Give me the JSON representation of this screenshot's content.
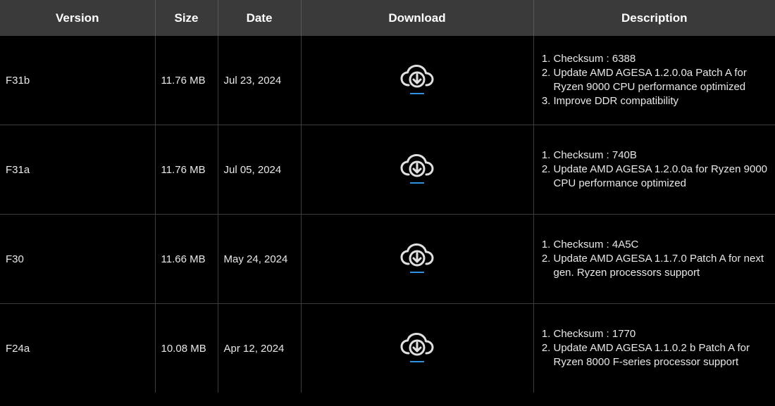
{
  "table": {
    "headers": {
      "version": "Version",
      "size": "Size",
      "date": "Date",
      "download": "Download",
      "description": "Description"
    },
    "rows": [
      {
        "version": "F31b",
        "size": "11.76 MB",
        "date": "Jul 23, 2024",
        "download_icon": "cloud-download-icon",
        "description": [
          "Checksum : 6388",
          "Update AMD AGESA 1.2.0.0a Patch A for Ryzen 9000 CPU performance optimized",
          "Improve DDR compatibility"
        ]
      },
      {
        "version": "F31a",
        "size": "11.76 MB",
        "date": "Jul 05, 2024",
        "download_icon": "cloud-download-icon",
        "description": [
          "Checksum : 740B",
          "Update AMD AGESA 1.2.0.0a for Ryzen 9000 CPU performance optimized"
        ]
      },
      {
        "version": "F30",
        "size": "11.66 MB",
        "date": "May 24, 2024",
        "download_icon": "cloud-download-icon",
        "description": [
          "Checksum : 4A5C",
          "Update AMD AGESA 1.1.7.0 Patch A for next gen. Ryzen processors support"
        ]
      },
      {
        "version": "F24a",
        "size": "10.08 MB",
        "date": "Apr 12, 2024",
        "download_icon": "cloud-download-icon",
        "description": [
          "Checksum : 1770",
          "Update AMD AGESA 1.1.0.2 b Patch A for Ryzen 8000 F-series processor support"
        ]
      }
    ]
  },
  "colors": {
    "header_bg": "#3a3a3a",
    "body_bg": "#000000",
    "icon_accent": "#2f8fe0"
  }
}
